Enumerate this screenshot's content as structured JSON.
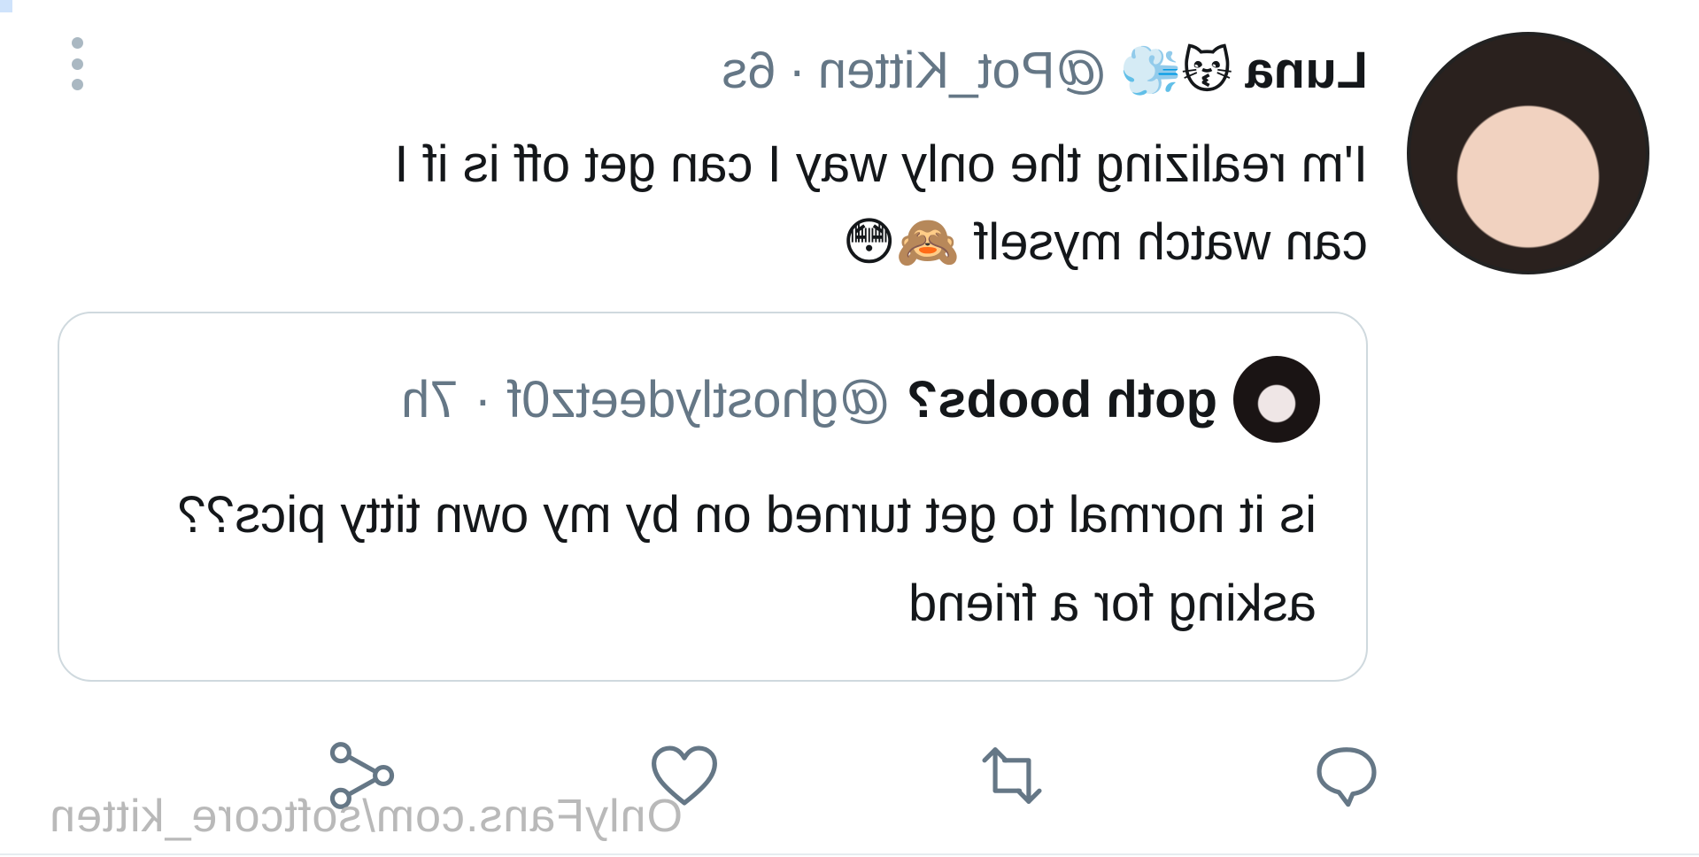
{
  "tweet": {
    "author_name": "Luna",
    "author_emojis": "😽💨",
    "handle": "@Pot_Kitten",
    "separator": "·",
    "time": "6s",
    "text": "I'm realizing the only way I can get off is if I\ncan watch myself 🙈😳"
  },
  "quoted": {
    "author_name": "goth boobs?",
    "handle": "@ghostlydeetz0f",
    "separator": "·",
    "time": "7h",
    "text": "is it normal to get turned on by my own titty pics?? asking for a friend"
  },
  "actions": {
    "reply": "reply-icon",
    "retweet": "retweet-icon",
    "like": "heart-icon",
    "share": "share-icon"
  },
  "watermark": "OnlyFans.com/softcore_kitten",
  "colors": {
    "text": "#14171a",
    "secondary": "#657786",
    "border": "#cfd9de",
    "watermark": "#b9b9b9"
  }
}
